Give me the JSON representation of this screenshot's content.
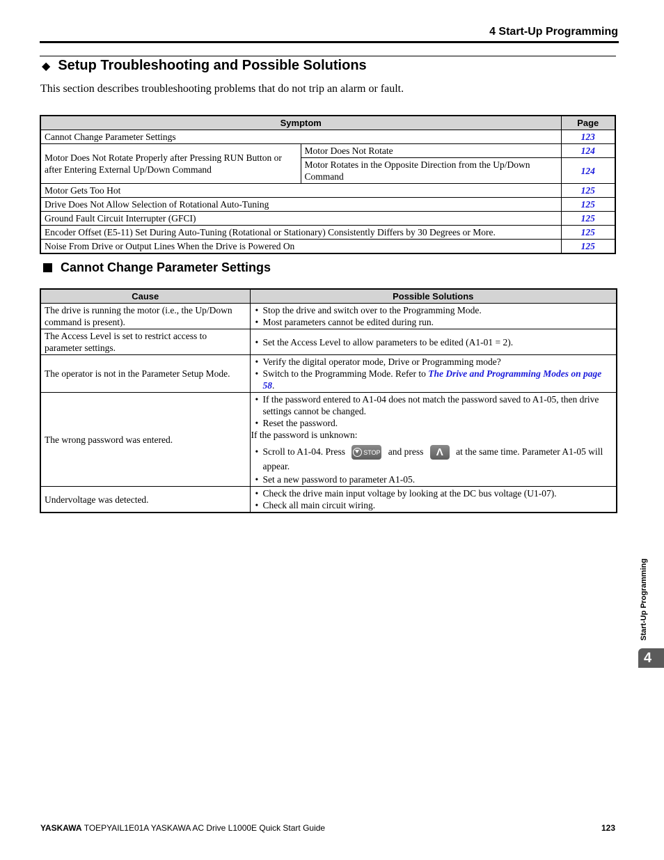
{
  "header": {
    "running_head": "4  Start-Up Programming"
  },
  "section": {
    "icon": "diamond-bullet",
    "title": "Setup Troubleshooting and Possible Solutions",
    "intro": "This section describes troubleshooting problems that do not trip an alarm or fault."
  },
  "symptom_table": {
    "headers": {
      "symptom": "Symptom",
      "page": "Page"
    },
    "rows": [
      {
        "symptom": "Cannot Change Parameter Settings",
        "page": "123"
      },
      {
        "group": "Motor Does Not Rotate Properly after Pressing RUN Button or after Entering External Up/Down Command",
        "sub": [
          {
            "symptom": "Motor Does Not Rotate",
            "page": "124"
          },
          {
            "symptom": "Motor Rotates in the Opposite Direction from the Up/Down Command",
            "page": "124"
          }
        ]
      },
      {
        "symptom": "Motor Gets Too Hot",
        "page": "125"
      },
      {
        "symptom": "Drive Does Not Allow Selection of Rotational Auto-Tuning",
        "page": "125"
      },
      {
        "symptom": "Ground Fault Circuit Interrupter (GFCI)",
        "page": "125"
      },
      {
        "symptom": "Encoder Offset (E5-11) Set During Auto-Tuning (Rotational or Stationary) Consistently Differs by 30 Degrees or More.",
        "page": "125"
      },
      {
        "symptom": "Noise From Drive or Output Lines When the Drive is Powered On",
        "page": "125"
      }
    ]
  },
  "subsection": {
    "icon": "square-bullet",
    "title": "Cannot Change Parameter Settings"
  },
  "cause_table": {
    "headers": {
      "cause": "Cause",
      "solutions": "Possible Solutions"
    },
    "rows": [
      {
        "cause": "The drive is running the motor (i.e., the Up/Down command is present).",
        "solutions": [
          "Stop the drive and switch over to the Programming Mode.",
          "Most parameters cannot be edited during run."
        ]
      },
      {
        "cause": "The Access Level is set to restrict access to parameter settings.",
        "solutions": [
          "Set the Access Level to allow parameters to be edited (A1-01 = 2)."
        ]
      },
      {
        "cause": "The operator is not in the Parameter Setup Mode.",
        "solutions": [
          "Verify the digital operator mode, Drive or Programming mode?"
        ],
        "link_item": {
          "prefix": "Switch to the Programming Mode. Refer to ",
          "link": "The Drive and Programming Modes on page 58",
          "suffix": "."
        }
      },
      {
        "cause": "The wrong password was entered.",
        "solutions": [
          "If the password entered to A1-04 does not match the password saved to A1-05, then drive settings cannot be changed.",
          "Reset the password."
        ],
        "note": "If the password is unknown:",
        "key_item": {
          "prefix": "Scroll to A1-04. Press",
          "key1": "STOP",
          "key1_icon": "stop-key-icon",
          "middle": "and press",
          "key2": "Λ",
          "key2_icon": "up-arrow-key-icon",
          "suffix": "at the same time. Parameter A1-05 will appear."
        },
        "final": "Set a new password to parameter A1-05."
      },
      {
        "cause": "Undervoltage was detected.",
        "solutions": [
          "Check the drive main input voltage by looking at the DC bus voltage (U1-07).",
          "Check all main circuit wiring."
        ]
      }
    ]
  },
  "side_tab": {
    "label": "Start-Up Programming",
    "chapter": "4"
  },
  "footer": {
    "brand": "YASKAWA",
    "doc": "TOEPYAIL1E01A YASKAWA AC Drive L1000E Quick Start Guide",
    "page_number": "123"
  },
  "colors": {
    "link": "#1a1adb",
    "header_fill": "#d4d4d4",
    "tab_fill": "#5b5b5b"
  }
}
